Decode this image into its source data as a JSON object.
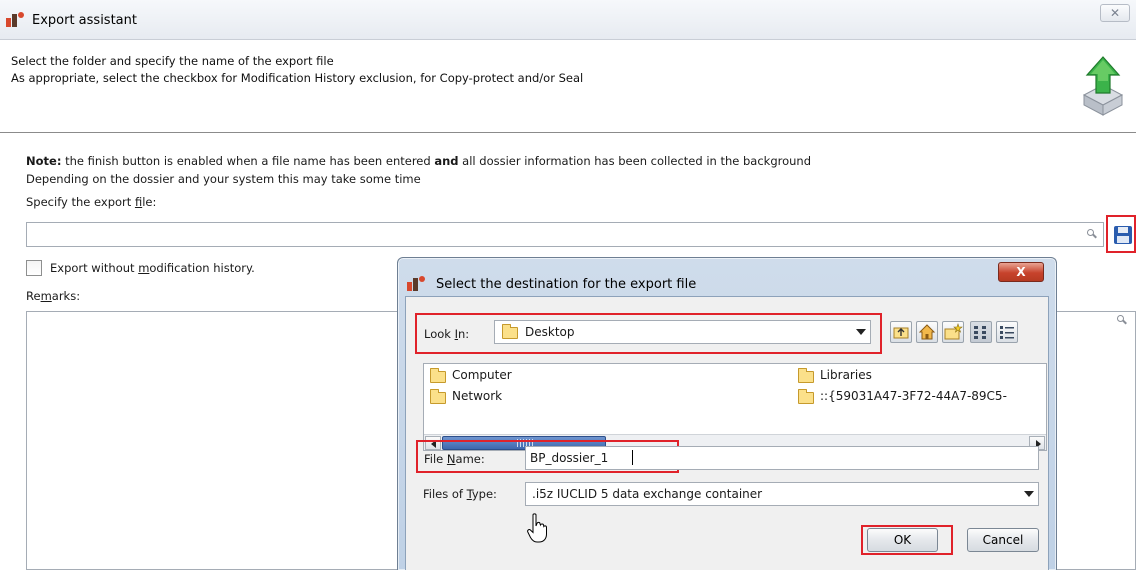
{
  "window": {
    "title": "Export assistant",
    "close_glyph": "✕"
  },
  "header": {
    "line1": "Select the folder and specify the name of the export file",
    "line2": "As appropriate, select the checkbox for Modification History exclusion, for Copy-protect and/or Seal",
    "graphic_icon": "export-arrow-icon"
  },
  "main": {
    "note_bold": "Note:",
    "note_part1": " the finish button is enabled when a file name has been entered ",
    "note_and": "and",
    "note_part2": " all dossier information has been collected in the background",
    "info_line": "Depending on the dossier and your system this may take some time",
    "specify_label_pre": "Specify the export ",
    "specify_label_mnemonic": "f",
    "specify_label_post": "ile:",
    "file_value": "",
    "checkbox_pre": "Export without ",
    "checkbox_mnemonic": "m",
    "checkbox_post": "odification history.",
    "checkbox_checked": false,
    "remarks_pre": "Re",
    "remarks_mnemonic": "m",
    "remarks_post": "arks:"
  },
  "dialog": {
    "title": "Select the destination for the export file",
    "close_glyph": "X",
    "look_in_pre": "Look ",
    "look_in_mnemonic": "I",
    "look_in_post": "n:",
    "look_in_value": "Desktop",
    "toolbar_icons": [
      "up-folder-icon",
      "home-icon",
      "new-folder-icon",
      "list-view-icon",
      "details-view-icon"
    ],
    "files": [
      {
        "name": "Computer"
      },
      {
        "name": "Libraries"
      },
      {
        "name": "Network"
      },
      {
        "name": "::{59031A47-3F72-44A7-89C5-"
      }
    ],
    "file_name_pre": "File ",
    "file_name_mnemonic": "N",
    "file_name_post": "ame:",
    "file_name_value": "BP_dossier_1",
    "files_of_type_pre": "Files of ",
    "files_of_type_mnemonic": "T",
    "files_of_type_post": "ype:",
    "files_of_type_value": ".i5z IUCLID 5 data exchange container",
    "ok_label": "OK",
    "cancel_label": "Cancel"
  },
  "colors": {
    "highlight_red": "#e0222a",
    "dialog_frame": "#bfd1e6",
    "accent_blue": "#2a5cae"
  }
}
